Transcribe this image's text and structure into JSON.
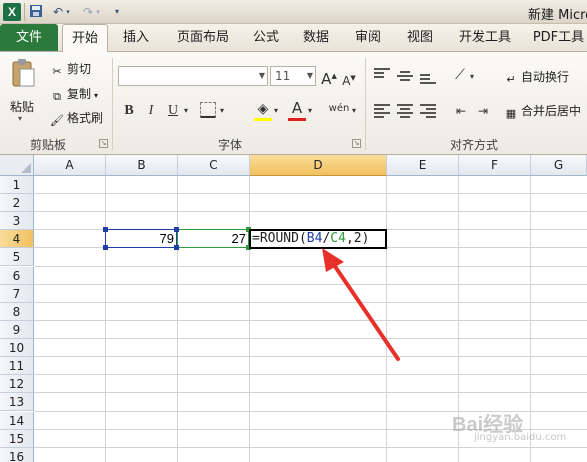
{
  "window": {
    "title": "新建 Micro"
  },
  "quick_access": {
    "icons": [
      "save-icon",
      "undo-icon",
      "redo-icon",
      "customize-icon"
    ]
  },
  "ribbon": {
    "file_tab": "文件",
    "tabs": [
      "开始",
      "插入",
      "页面布局",
      "公式",
      "数据",
      "审阅",
      "视图",
      "开发工具",
      "PDF工具"
    ],
    "active_tab": "开始",
    "clipboard": {
      "paste": "粘贴",
      "cut": "剪切",
      "copy": "复制",
      "format_painter": "格式刷",
      "label": "剪贴板"
    },
    "font": {
      "font_name": "",
      "font_size": "11",
      "label": "字体",
      "bold": "B",
      "italic": "I",
      "underline": "U",
      "grow": "A",
      "shrink": "A",
      "phonetic": "wén"
    },
    "alignment": {
      "wrap_text": "自动换行",
      "merge_center": "合并后居中",
      "label": "对齐方式"
    }
  },
  "sheet": {
    "columns": [
      "A",
      "B",
      "C",
      "D",
      "E",
      "F",
      "G"
    ],
    "selected_column": "D",
    "rows": [
      "1",
      "2",
      "3",
      "4",
      "5",
      "6",
      "7",
      "8",
      "9",
      "10",
      "11",
      "12",
      "13",
      "14",
      "15",
      "16"
    ],
    "selected_row": "4",
    "cells": {
      "B4": "79",
      "C4": "27"
    },
    "active_cell": {
      "ref": "D4",
      "formula_prefix": "=ROUND(",
      "ref1": "B4",
      "slash": "/",
      "ref2": "C4",
      "formula_suffix": ",2)"
    }
  },
  "colors": {
    "file_tab": "#2b7a3b",
    "ref_b4": "#1f3ea8",
    "ref_c4": "#2e9a3a",
    "arrow": "#e8302a",
    "header_selected": "#f1c15f"
  },
  "watermark": {
    "brand": "Bai经验",
    "sub": "jingyan.baidu.com"
  }
}
